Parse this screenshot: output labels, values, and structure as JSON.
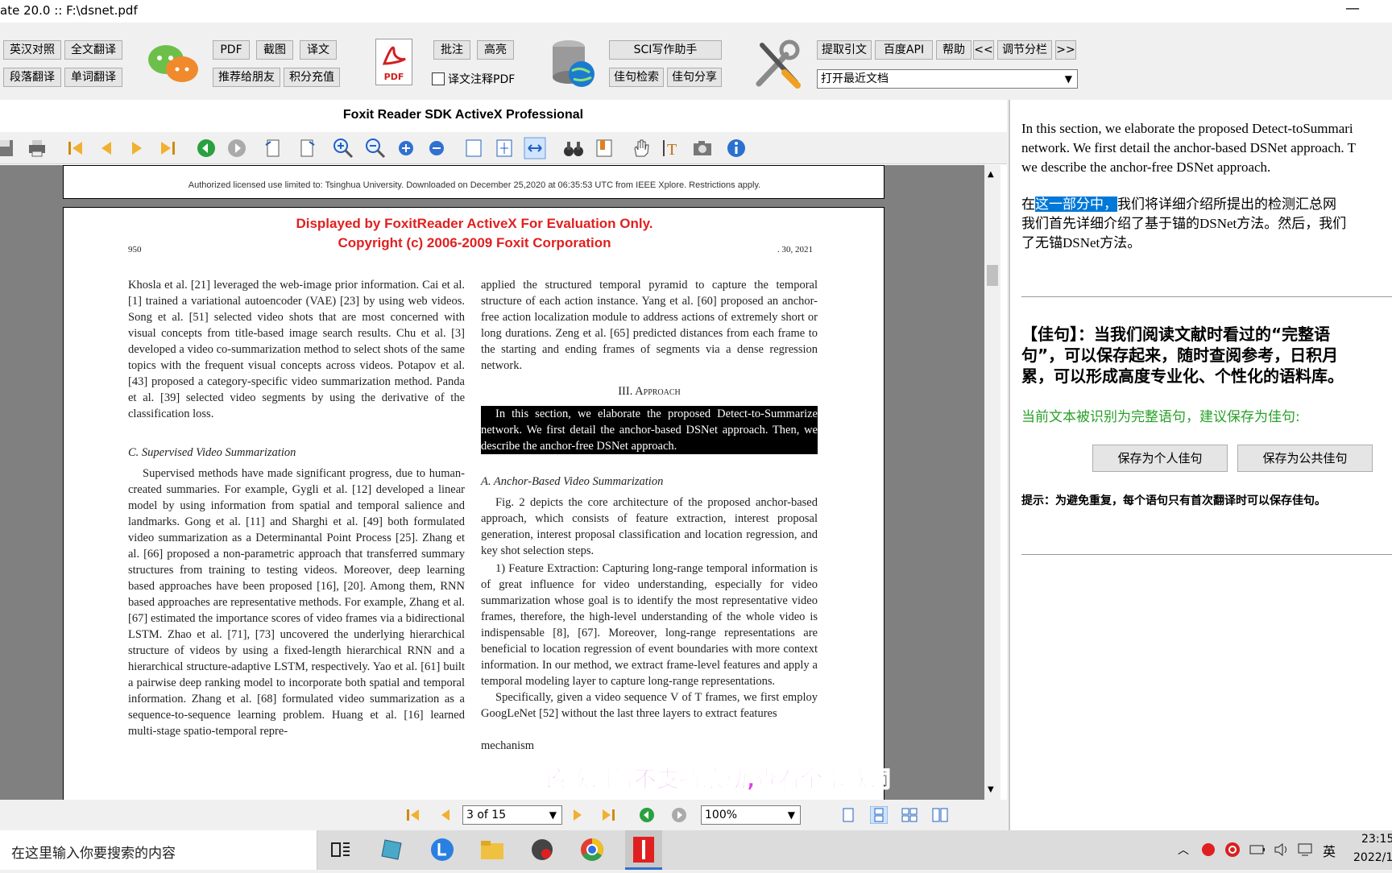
{
  "window": {
    "title": "ate 20.0 :: F:\\dsnet.pdf",
    "min_glyph": "—"
  },
  "toolbar": {
    "row1": [
      "英汉对照",
      "全文翻译",
      "PDF",
      "截图",
      "译文",
      "批注",
      "高亮",
      "SCI写作助手",
      "提取引文",
      "百度API",
      "帮助",
      "<<",
      "调节分栏",
      ">>"
    ],
    "row2": [
      "段落翻译",
      "单词翻译",
      "推荐给朋友",
      "积分充值",
      "佳句检索",
      "佳句分享"
    ],
    "checkbox_label": "译文注释PDF",
    "pdf_icon_text": "PDF",
    "recent_combo": "打开最近文档"
  },
  "viewer": {
    "title": "Foxit Reader SDK ActiveX Professional",
    "license_line": "Authorized licensed use limited to: Tsinghua University. Downloaded on December 25,2020 at 06:35:53 UTC from IEEE Xplore.  Restrictions apply.",
    "eval_line1": "Displayed by FoxitReader ActiveX For Evaluation Only.",
    "eval_line2": "Copyright (c) 2006-2009 Foxit Corporation",
    "page_number": "950",
    "header_right": ". 30, 2021",
    "left_col_p1": "Khosla et al. [21] leveraged the web-image prior information. Cai et al. [1] trained a variational autoencoder (VAE) [23] by using web videos. Song et al. [51] selected video shots that are most concerned with visual concepts from title-based image search results. Chu et al. [3] developed a video co-summarization method to select shots of the same topics with the frequent visual concepts across videos. Potapov et al. [43] proposed a category-specific video summarization method. Panda et al. [39] selected video segments by using the derivative of the classification loss.",
    "left_col_heading": "C. Supervised Video Summarization",
    "left_col_p2": "Supervised methods have made significant progress, due to human-created summaries. For example, Gygli et al. [12] developed a linear model by using information from spatial and temporal salience and landmarks. Gong et al. [11] and Sharghi et al. [49] both formulated video summarization as a Determinantal Point Process [25]. Zhang et al. [66] proposed a non-parametric approach that transferred summary structures from training to testing videos. Moreover, deep learning based approaches have been proposed [16], [20]. Among them, RNN based approaches are representative methods. For example, Zhang et al. [67] estimated the importance scores of video frames via a bidirectional LSTM. Zhao et al. [71], [73] uncovered the underlying hierarchical structure of videos by using a fixed-length hierarchical RNN and a hierarchical structure-adaptive LSTM, respectively. Yao et al. [61] built a pairwise deep ranking model to incorporate both spatial and temporal information. Zhang et al. [68] formulated video summarization as a sequence-to-sequence learning problem. Huang et al. [16] learned multi-stage spatio-temporal repre-",
    "right_col_p1": "applied the structured temporal pyramid to capture the temporal structure of each action instance. Yang et al. [60] proposed an anchor-free action localization module to address actions of extremely short or long durations. Zeng et al. [65] predicted distances from each frame to the starting and ending frames of segments via a dense regression network.",
    "right_col_heading": "III. Approach",
    "right_col_selected": "In this section, we elaborate the proposed Detect-to-Summarize network. We first detail the anchor-based DSNet approach. Then, we describe the anchor-free DSNet approach.",
    "right_col_subheading": "A. Anchor-Based Video Summarization",
    "right_col_p2": "Fig. 2 depicts the core architecture of the proposed anchor-based approach, which consists of feature extraction, interest proposal generation, interest proposal classification and location regression, and key shot selection steps.",
    "right_col_p3": "1) Feature Extraction: Capturing long-range temporal information is of great influence for video understanding, especially for video summarization whose goal is to identify the most representative video frames, therefore, the high-level understanding of the whole video is indispensable [8], [67]. Moreover, long-range representations are beneficial to location regression of event boundaries with more context information. In our method, we extract frame-level features and apply a temporal modeling layer to capture long-range representations.",
    "right_col_p4": "Specifically, given a video sequence V of T frames, we first employ GoogLeNet [52] without the last three layers to extract features",
    "right_col_p5": "mechanism",
    "subtitle_overlay": "该歌词暂不支持滚动,查看全部歌词"
  },
  "navbar": {
    "page_display": "3 of 15",
    "zoom": "100%"
  },
  "rightpanel": {
    "src_line1": "In this section, we elaborate the proposed Detect-toSummari",
    "src_line2": "network. We first detail the anchor-based DSNet approach. T",
    "src_line3": "we describe the anchor-free DSNet approach.",
    "trans_prefix": "在",
    "trans_selected": "这一部分中，",
    "trans_rest1": "我们将详细介绍所提出的检测汇总网",
    "trans_line2": "我们首先详细介绍了基于锚的DSNet方法。然后，我们",
    "trans_line3": "了无锚DSNet方法。",
    "jiaju_line1": "【佳句】：当我们阅读文献时看过的“完整语",
    "jiaju_line2": "句”，可以保存起来，随时查阅参考，日积月",
    "jiaju_line3": "累，可以形成高度专业化、个性化的语料库。",
    "recognized": "当前文本被识别为完整语句，建议保存为佳句:",
    "save_personal": "保存为个人佳句",
    "save_public": "保存为公共佳句",
    "tip": "提示：为避免重复，每个语句只有首次翻译时可以保存佳句。"
  },
  "taskbar": {
    "search_placeholder": "在这里输入你要搜索的内容",
    "ime": "英",
    "time": "23:15",
    "date": "2022/1"
  },
  "colors": {
    "accent_green": "#28a028",
    "eval_red": "#e02020",
    "selection_blue": "#0078d7",
    "subtitle_magenta": "#e040e0"
  }
}
